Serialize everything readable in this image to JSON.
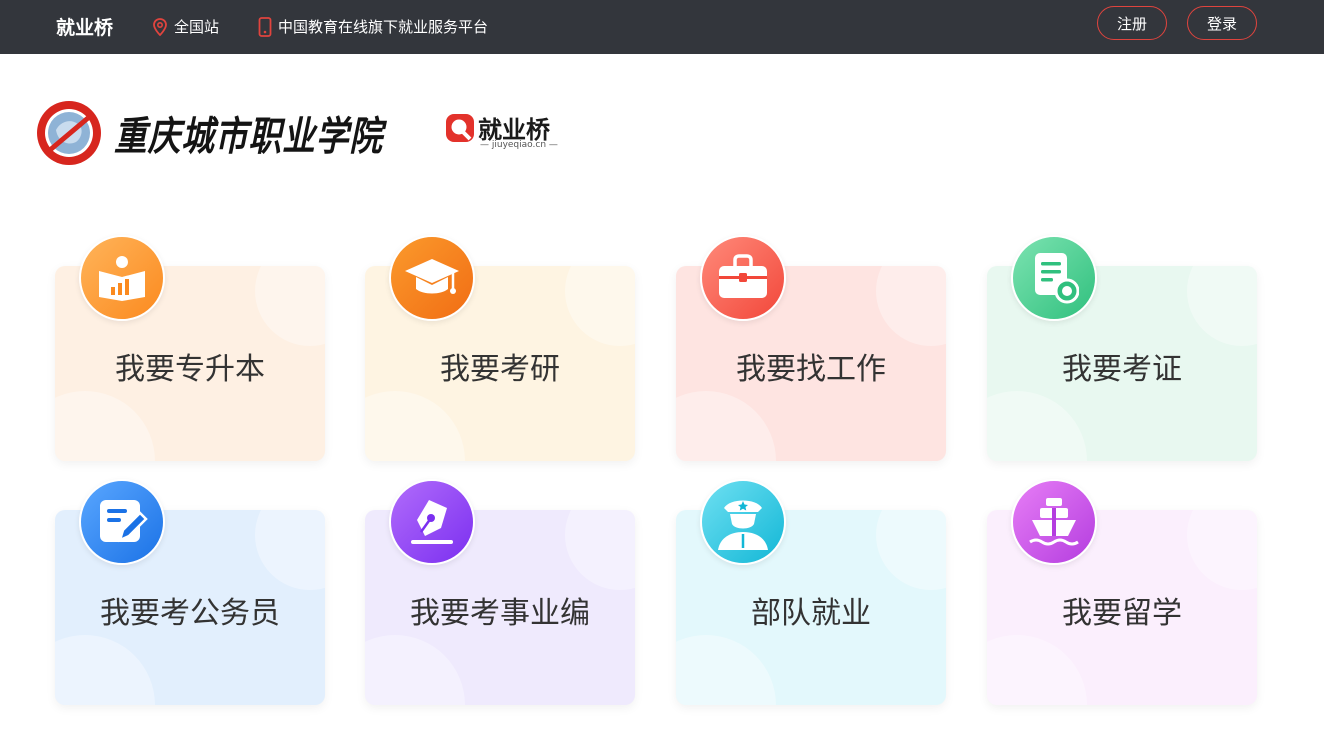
{
  "topbar": {
    "brand": "就业桥",
    "site_label": "全国站",
    "slogan": "中国教育在线旗下就业服务平台",
    "register_label": "注册",
    "login_label": "登录",
    "bg_color": "#33363c",
    "accent_color": "#e0443e"
  },
  "logo": {
    "school_name": "重庆城市职业学院",
    "platform_name": "就业桥",
    "platform_domain": "— jiuyeqiao.cn —"
  },
  "cards": [
    {
      "label": "我要专升本",
      "icon": "open-book-chart-icon"
    },
    {
      "label": "我要考研",
      "icon": "graduation-cap-icon"
    },
    {
      "label": "我要找工作",
      "icon": "briefcase-icon"
    },
    {
      "label": "我要考证",
      "icon": "certificate-icon"
    },
    {
      "label": "我要考公务员",
      "icon": "edit-document-icon"
    },
    {
      "label": "我要考事业编",
      "icon": "pen-nib-icon"
    },
    {
      "label": "部队就业",
      "icon": "soldier-icon"
    },
    {
      "label": "我要留学",
      "icon": "ship-icon"
    }
  ]
}
